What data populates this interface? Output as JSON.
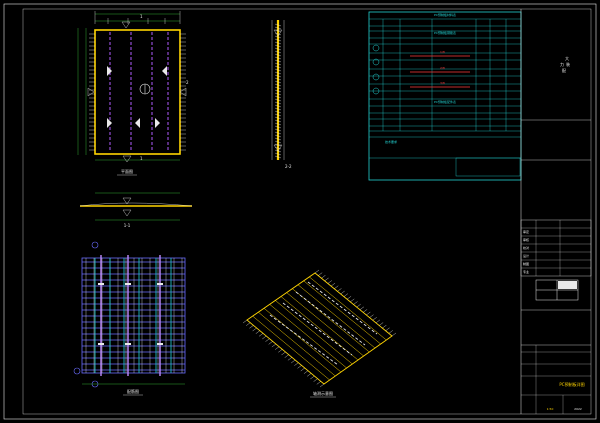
{
  "views": {
    "plan_title": "平面图",
    "section_1_label": "1-1",
    "section_2_label": "2-2",
    "reinforcement_title": "配筋图",
    "axonometric_title": "轴测示意图",
    "section_mark_1": "1",
    "section_mark_2": "2"
  },
  "table": {
    "title1": "PC预制板材料表",
    "title2": "PC预制板钢筋表",
    "title3": "PC预制板配件表",
    "red_marks": [
      "1/8",
      "2/8",
      "3/8"
    ]
  },
  "notes": {
    "spec_label": "技术要求"
  },
  "title_block": {
    "side_chars": [
      "大",
      "力",
      "装",
      "配"
    ],
    "rows": [
      "审定",
      "审核",
      "校对",
      "设计",
      "制图",
      "专业",
      "比例"
    ],
    "drawing_name": "PC预制板详图",
    "scale": "1:50",
    "date": "2022"
  },
  "colors": {
    "background": "#000000",
    "cyan": "#22d3d3",
    "yellow": "#ffd400",
    "magenta": "#ff55ff",
    "blue": "#6a6cff",
    "white": "#e8e8e8",
    "red": "#ff3b3b",
    "green": "#3cd13c"
  }
}
